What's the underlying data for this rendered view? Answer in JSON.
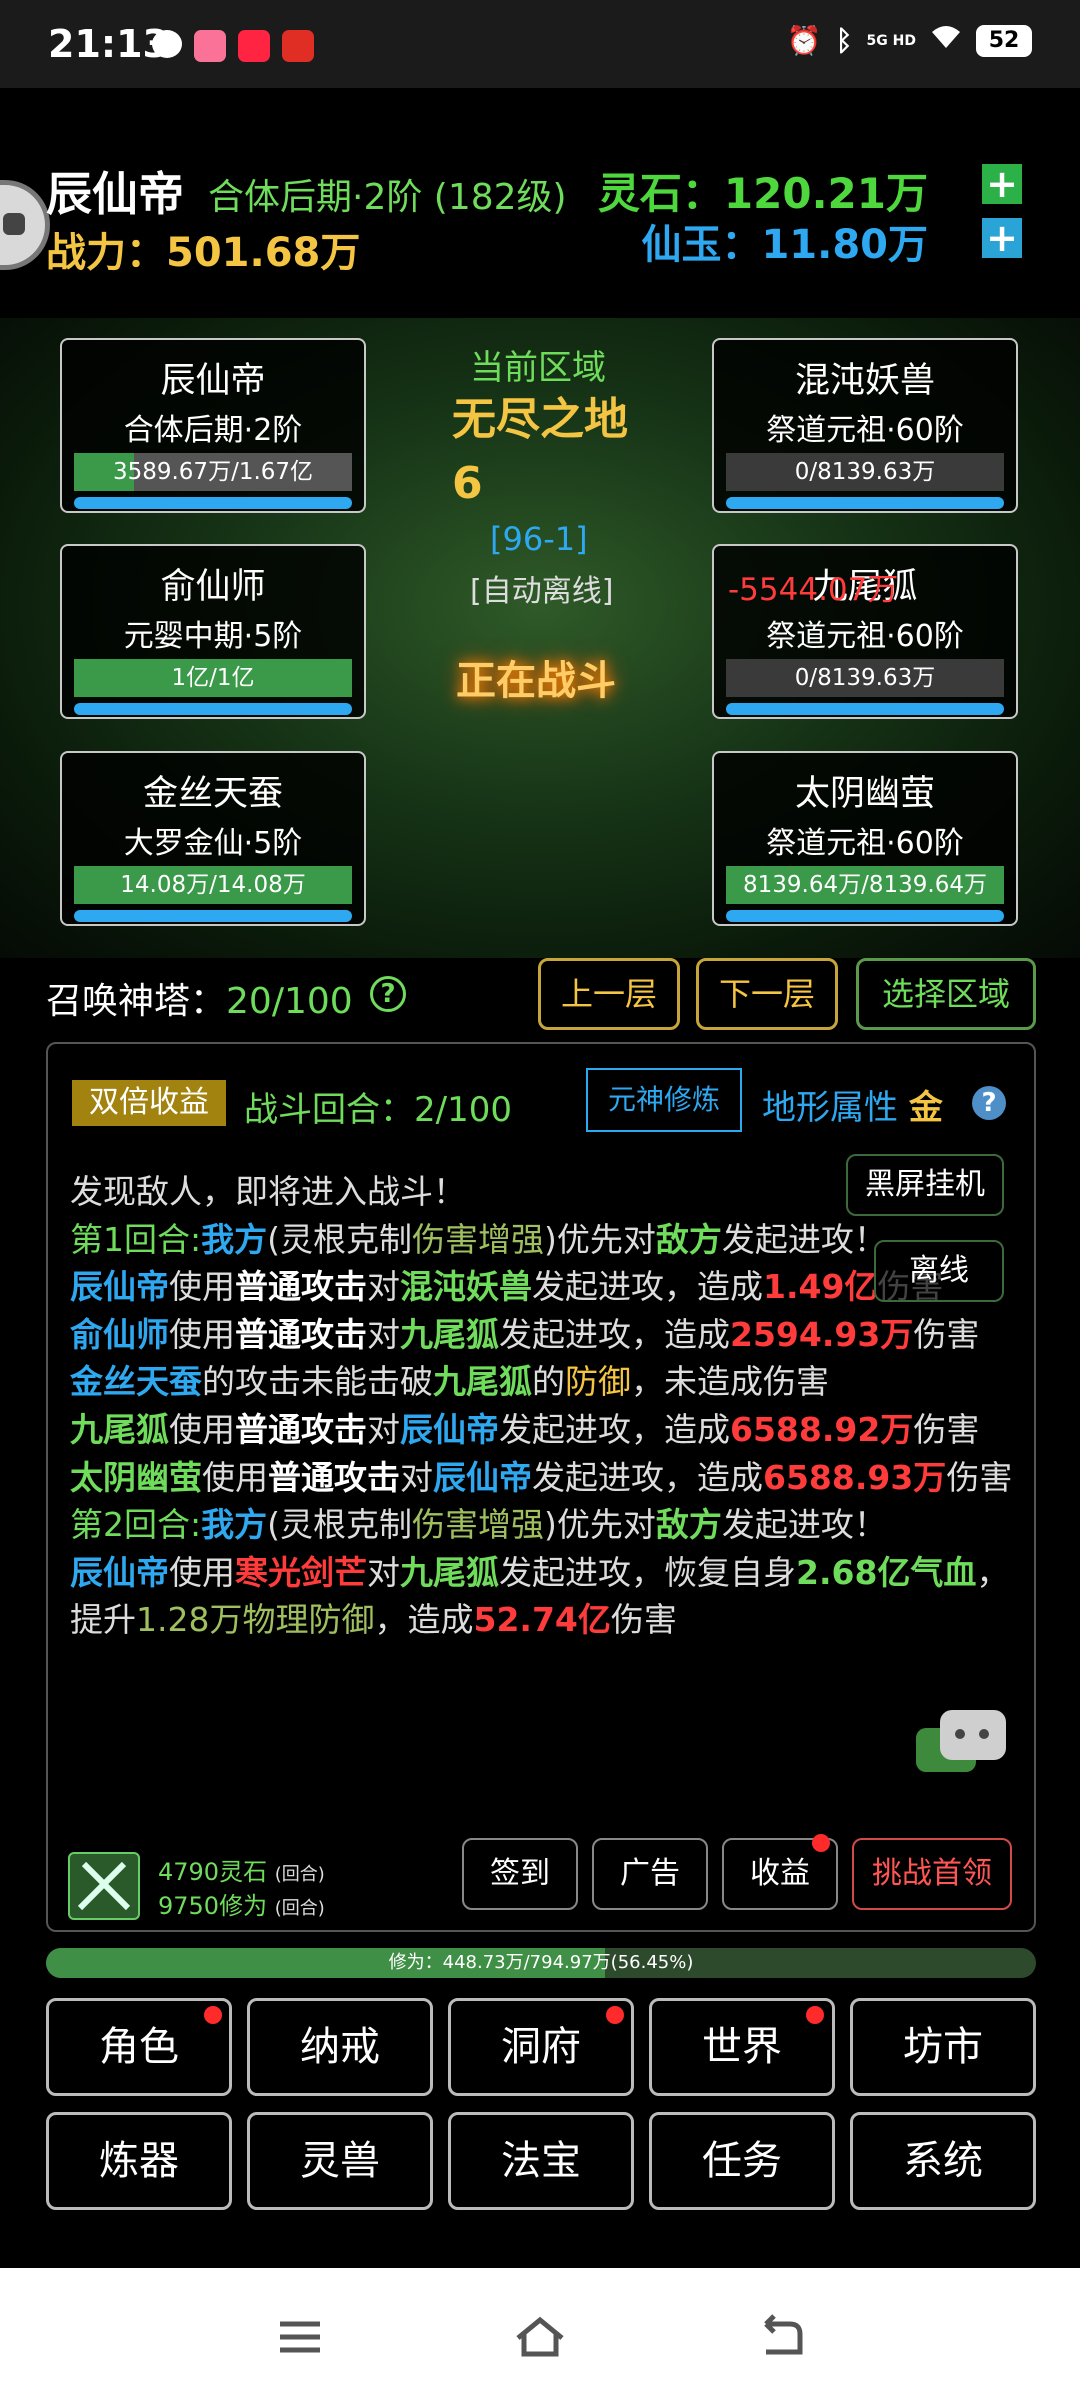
{
  "status_bar": {
    "time": "21:13",
    "notif_apps": [
      "chat-icon",
      "bilibili-icon",
      "xiaohongshu-icon",
      "pinduoduo-icon"
    ],
    "battery": "52",
    "network": "5G HD"
  },
  "header": {
    "player_name": "辰仙帝",
    "realm": "合体后期·2阶 (182级)",
    "power_label": "战力：",
    "power_value": "501.68万",
    "lingshi_label": "灵石：",
    "lingshi_value": "120.21万",
    "xianyu_label": "仙玉：",
    "xianyu_value": "11.80万",
    "plus": "+"
  },
  "battle": {
    "zone_label": "当前区域",
    "zone_name": "无尽之地6",
    "zone_code": "[96-1]",
    "zone_mode": "[自动离线]",
    "status": "正在战斗",
    "damage_popup": "-5544.07万",
    "allies": [
      {
        "name": "辰仙帝",
        "realm": "合体后期·2阶",
        "hp": "3589.67万/1.67亿",
        "hp_ratio": 0.215
      },
      {
        "name": "俞仙师",
        "realm": "元婴中期·5阶",
        "hp": "1亿/1亿",
        "hp_ratio": 1.0
      },
      {
        "name": "金丝天蚕",
        "realm": "大罗金仙·5阶",
        "hp": "14.08万/14.08万",
        "hp_ratio": 1.0
      }
    ],
    "enemies": [
      {
        "name": "混沌妖兽",
        "realm": "祭道元祖·60阶",
        "hp": "0/8139.63万",
        "hp_ratio": 0
      },
      {
        "name": "九尾狐",
        "realm": "祭道元祖·60阶",
        "hp": "0/8139.63万",
        "hp_ratio": 0
      },
      {
        "name": "太阴幽萤",
        "realm": "祭道元祖·60阶",
        "hp": "8139.64万/8139.64万",
        "hp_ratio": 1.0
      }
    ]
  },
  "tower": {
    "label": "召唤神塔：",
    "value": "20/100",
    "help": "?",
    "btn_up": "上一层",
    "btn_down": "下一层",
    "btn_select": "选择区域"
  },
  "panel": {
    "double_label": "双倍收益",
    "round_label": "战斗回合：",
    "round_value": "2/100",
    "yuanshen_btn": "元神修炼",
    "terrain_label": "地形属性",
    "terrain_value": "金",
    "terrain_help": "?",
    "blackscreen_btn": "黑屏挂机",
    "offline_btn": "离线",
    "log": {
      "l1": "发现敌人，即将进入战斗！",
      "l2a": "第1回合:",
      "l2b": "我方",
      "l2c": "(灵根克制",
      "l2d": "伤害增强",
      "l2e": ")优先对",
      "l2f": "敌方",
      "l2g": "发起进攻！",
      "l3a": "辰仙帝",
      "l3b": "使用",
      "l3c": "普通攻击",
      "l3d": "对",
      "l3e": "混沌妖兽",
      "l3f": "发起进攻，造成",
      "l3g": "1.49亿",
      "l3h": "伤害",
      "l4a": "俞仙师",
      "l4b": "使用",
      "l4c": "普通攻击",
      "l4d": "对",
      "l4e": "九尾狐",
      "l4f": "发起进攻，造成",
      "l4g": "2594.93万",
      "l4h": "伤害",
      "l5a": "金丝天蚕",
      "l5b": "的攻击未能击破",
      "l5c": "九尾狐",
      "l5d": "的",
      "l5e": "防御",
      "l5f": "，未造成伤害",
      "l6a": "九尾狐",
      "l6b": "使用",
      "l6c": "普通攻击",
      "l6d": "对",
      "l6e": "辰仙帝",
      "l6f": "发起进攻，造成",
      "l6g": "6588.92万",
      "l6h": "伤害",
      "l7a": "太阴幽萤",
      "l7b": "使用",
      "l7c": "普通攻击",
      "l7d": "对",
      "l7e": "辰仙帝",
      "l7f": "发起进攻，造成",
      "l7g": "6588.93万",
      "l7h": "伤害",
      "l8a": "第2回合:",
      "l8b": "我方",
      "l8c": "(灵根克制",
      "l8d": "伤害增强",
      "l8e": ")优先对",
      "l8f": "敌方",
      "l8g": "发起进攻！",
      "l9a": "辰仙帝",
      "l9b": "使用",
      "l9c": "寒光剑芒",
      "l9d": "对",
      "l9e": "九尾狐",
      "l9f": "发起进攻，恢复自身",
      "l9g": "2.68亿气血",
      "l9h": "，提升",
      "l9i": "1.28万物理防御",
      "l9j": "，造成",
      "l9k": "52.74亿",
      "l9l": "伤害"
    },
    "reward_lingshi": "4790灵石",
    "reward_xiuwei": "9750修为",
    "per_round": "(回合)",
    "btn_signin": "签到",
    "btn_ad": "广告",
    "btn_income": "收益",
    "btn_boss": "挑战首领"
  },
  "xp": {
    "text": "修为：448.73万/794.97万(56.45%)",
    "ratio": 0.5645
  },
  "nav": {
    "row1": [
      "角色",
      "纳戒",
      "洞府",
      "世界",
      "坊市"
    ],
    "row2": [
      "炼器",
      "灵兽",
      "法宝",
      "任务",
      "系统"
    ]
  },
  "colors": {
    "green": "#6fdc5c",
    "blue": "#2ea8f0",
    "gold": "#f4c542",
    "red": "#ff3b3b"
  }
}
